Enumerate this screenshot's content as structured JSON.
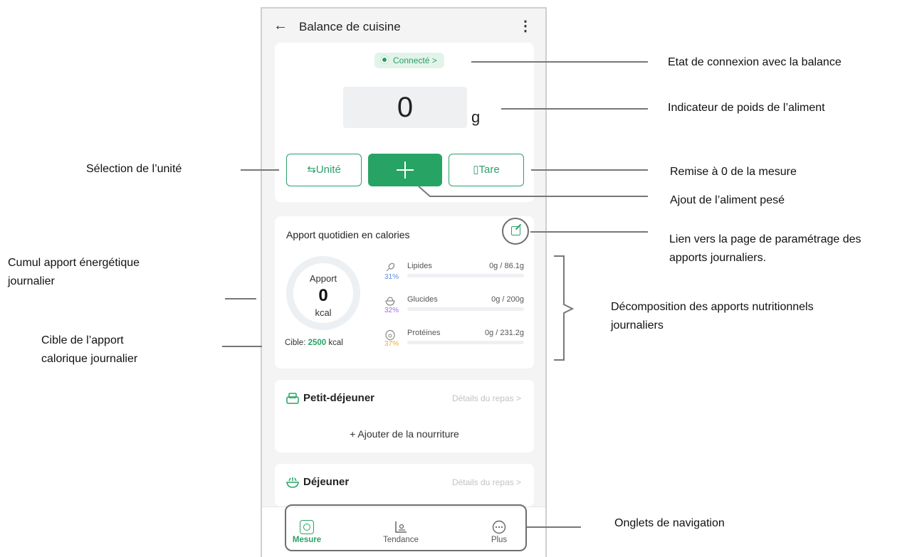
{
  "app": {
    "title": "Balance de cuisine",
    "back_icon": "arrow-left-icon",
    "more_icon": "more-vertical-icon"
  },
  "scale": {
    "status": "Connecté >",
    "weight_value": "0",
    "weight_unit": "g",
    "unit_button": "Unité",
    "tare_button": "Tare"
  },
  "daily": {
    "title": "Apport quotidien en calories",
    "ring_label": "Apport",
    "ring_value": "0",
    "ring_unit": "kcal",
    "target_prefix": "Cible: ",
    "target_value": "2500",
    "target_unit": " kcal",
    "nutrients": [
      {
        "name": "Lipides",
        "amount": "0g / 86.1g",
        "pct": "31%",
        "color": "#5b8fe0"
      },
      {
        "name": "Glucides",
        "amount": "0g / 200g",
        "pct": "32%",
        "color": "#9c6fe0"
      },
      {
        "name": "Protéines",
        "amount": "0g / 231.2g",
        "pct": "37%",
        "color": "#f0a93c"
      }
    ]
  },
  "meals": [
    {
      "name": "Petit-déjeuner",
      "link": "Détails du repas >",
      "add": "+ Ajouter de la nourriture"
    },
    {
      "name": "Déjeuner",
      "link": "Détails du repas >"
    }
  ],
  "nav": [
    {
      "label": "Mesure",
      "icon": "scale-icon"
    },
    {
      "label": "Tendance",
      "icon": "trend-chart-icon"
    },
    {
      "label": "Plus",
      "icon": "more-circle-icon"
    }
  ],
  "annotations": {
    "connexion": "Etat de connexion avec la balance",
    "poids": "Indicateur de poids de l’aliment",
    "unite": "Sélection de l’unité",
    "remise": "Remise à 0 de la mesure",
    "ajout": "Ajout de l’aliment pesé",
    "lien_1": "Lien vers la page de paramétrage des",
    "lien_2": "apports journaliers.",
    "cumul_1": "Cumul apport énergétique",
    "cumul_2": "journalier",
    "decomp_1": "Décomposition des apports nutritionnels",
    "decomp_2": "journaliers",
    "cible_1": "Cible de l’apport",
    "cible_2": "calorique journalier",
    "onglets": "Onglets de navigation"
  },
  "colors": {
    "accent": "#27a464",
    "annotation_lines": "#777777"
  }
}
